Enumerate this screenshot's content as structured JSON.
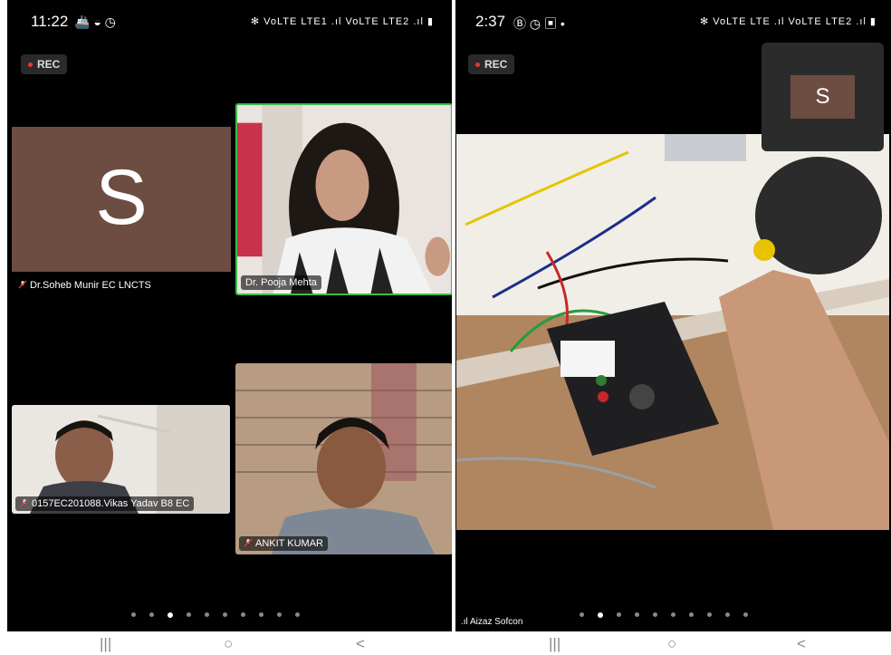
{
  "left_screen": {
    "status": {
      "time": "11:22",
      "icons_right": "✻ VoLTE LTE1 .ıl VoLTE LTE2 .ıl ▮"
    },
    "rec_label": "REC",
    "tiles": [
      {
        "avatar_letter": "S",
        "name": "Dr.Soheb Munir EC LNCTS",
        "muted": true,
        "avatar_color": "#6d4c41"
      },
      {
        "name": "Dr. Pooja Mehta",
        "muted": false,
        "active_speaker": true
      },
      {
        "name": "0157EC201088.Vikas Yadav B8 EC",
        "muted": true
      },
      {
        "name": "ANKIT KUMAR",
        "muted": true
      }
    ],
    "page_dots": 10,
    "active_dot": 2
  },
  "right_screen": {
    "status": {
      "time": "2:37",
      "icons_right": "✻ VoLTE LTE .ıl VoLTE LTE2 .ıl ▮"
    },
    "rec_label": "REC",
    "self_view_letter": "S",
    "main_video_name": "Aizaz Sofcon",
    "page_dots": 10,
    "active_dot": 1
  },
  "nav": {
    "recents": "|||",
    "home": "○",
    "back": "<"
  },
  "colors": {
    "avatar": "#6d4c41",
    "active_border": "#35c04b",
    "rec_dot": "#e53935"
  }
}
